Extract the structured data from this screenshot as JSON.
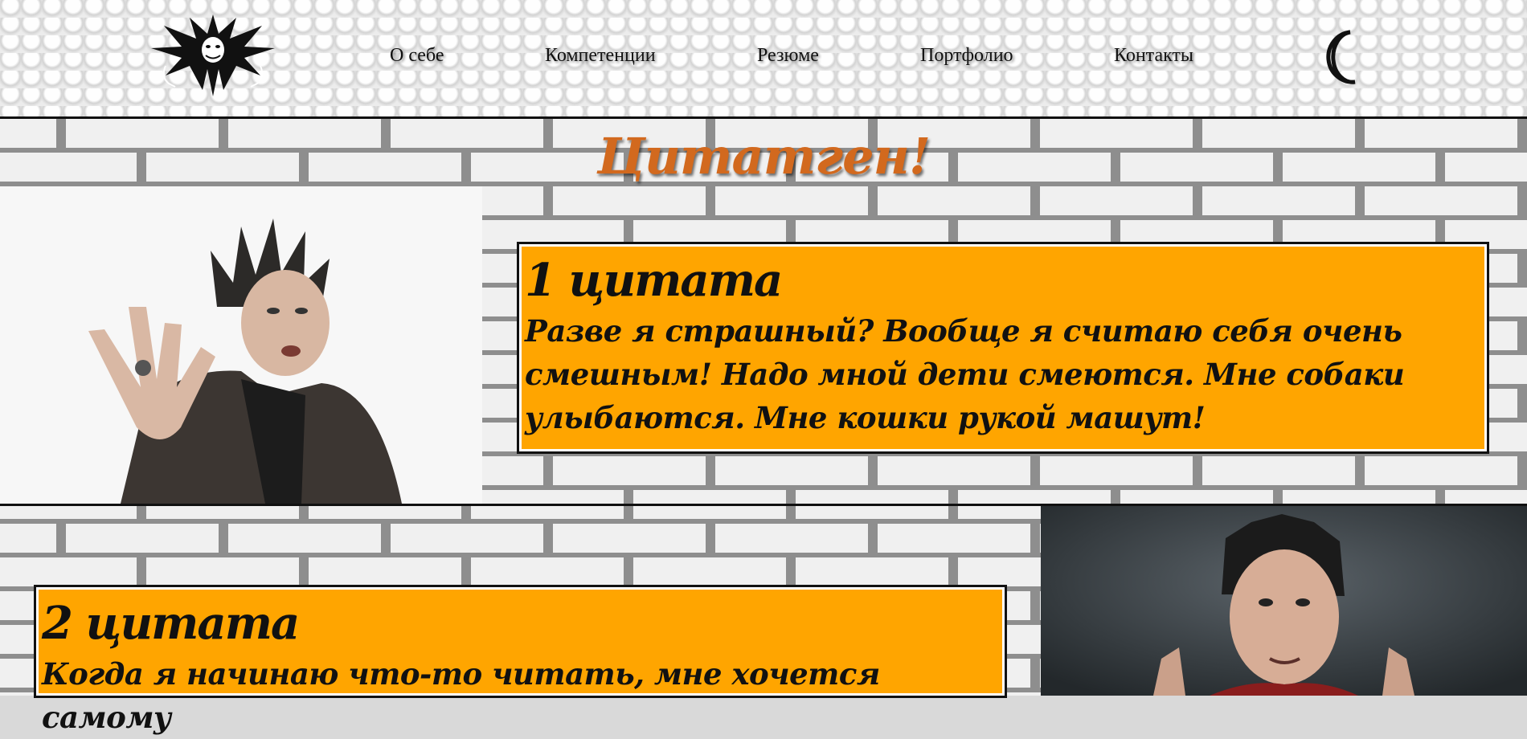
{
  "header": {
    "nav": [
      "О себе",
      "Компетенции",
      "Резюме",
      "Портфолио",
      "Контакты"
    ],
    "logo_icon": "jester-logo",
    "theme_icon": "moon-icon"
  },
  "page": {
    "title": "Цитатген!"
  },
  "quotes": [
    {
      "heading": "1 цитата",
      "text": "Разве я страшный? Вообще я считаю себя очень смешным! Надо мной дети смеются. Мне собаки улыбаются. Мне кошки рукой машут!"
    },
    {
      "heading": "2 цитата",
      "text": "Когда я начинаю что-то читать, мне хочется самому"
    }
  ],
  "colors": {
    "accent": "#ffa500",
    "title": "#d2691e"
  }
}
